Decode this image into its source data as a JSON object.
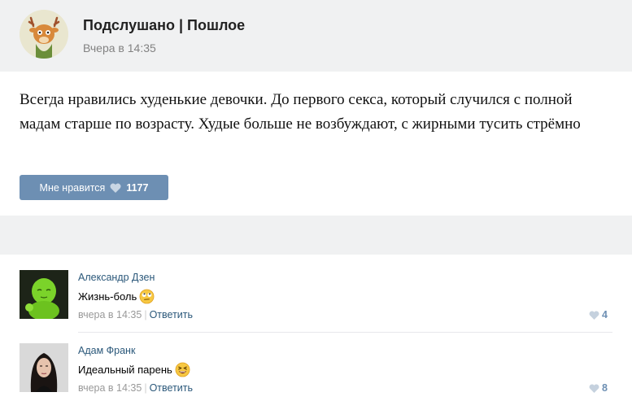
{
  "post": {
    "group_name": "Подслушано | Пошлое",
    "time": "Вчера в 14:35",
    "text": "Всегда нравились худенькие девочки. До первого секса, который случился с полной мадам старше по возрасту. Худые больше не возбуждают, с жирными тусить стрёмно",
    "like_label": "Мне нравится",
    "like_count": "1177"
  },
  "comments": [
    {
      "author": "Александр Дзен",
      "text": "Жизнь-боль",
      "time": "вчера в 14:35",
      "reply_label": "Ответить",
      "likes": "4",
      "emoji": "rolling-eyes-emoji"
    },
    {
      "author": "Адам Франк",
      "text": "Идеальный парень",
      "time": "вчера в 14:35",
      "reply_label": "Ответить",
      "likes": "8",
      "emoji": "laughing-emoji"
    }
  ],
  "colors": {
    "header_bg": "#f0f1f2",
    "like_button": "#6d8fb3",
    "link": "#2b587a"
  }
}
